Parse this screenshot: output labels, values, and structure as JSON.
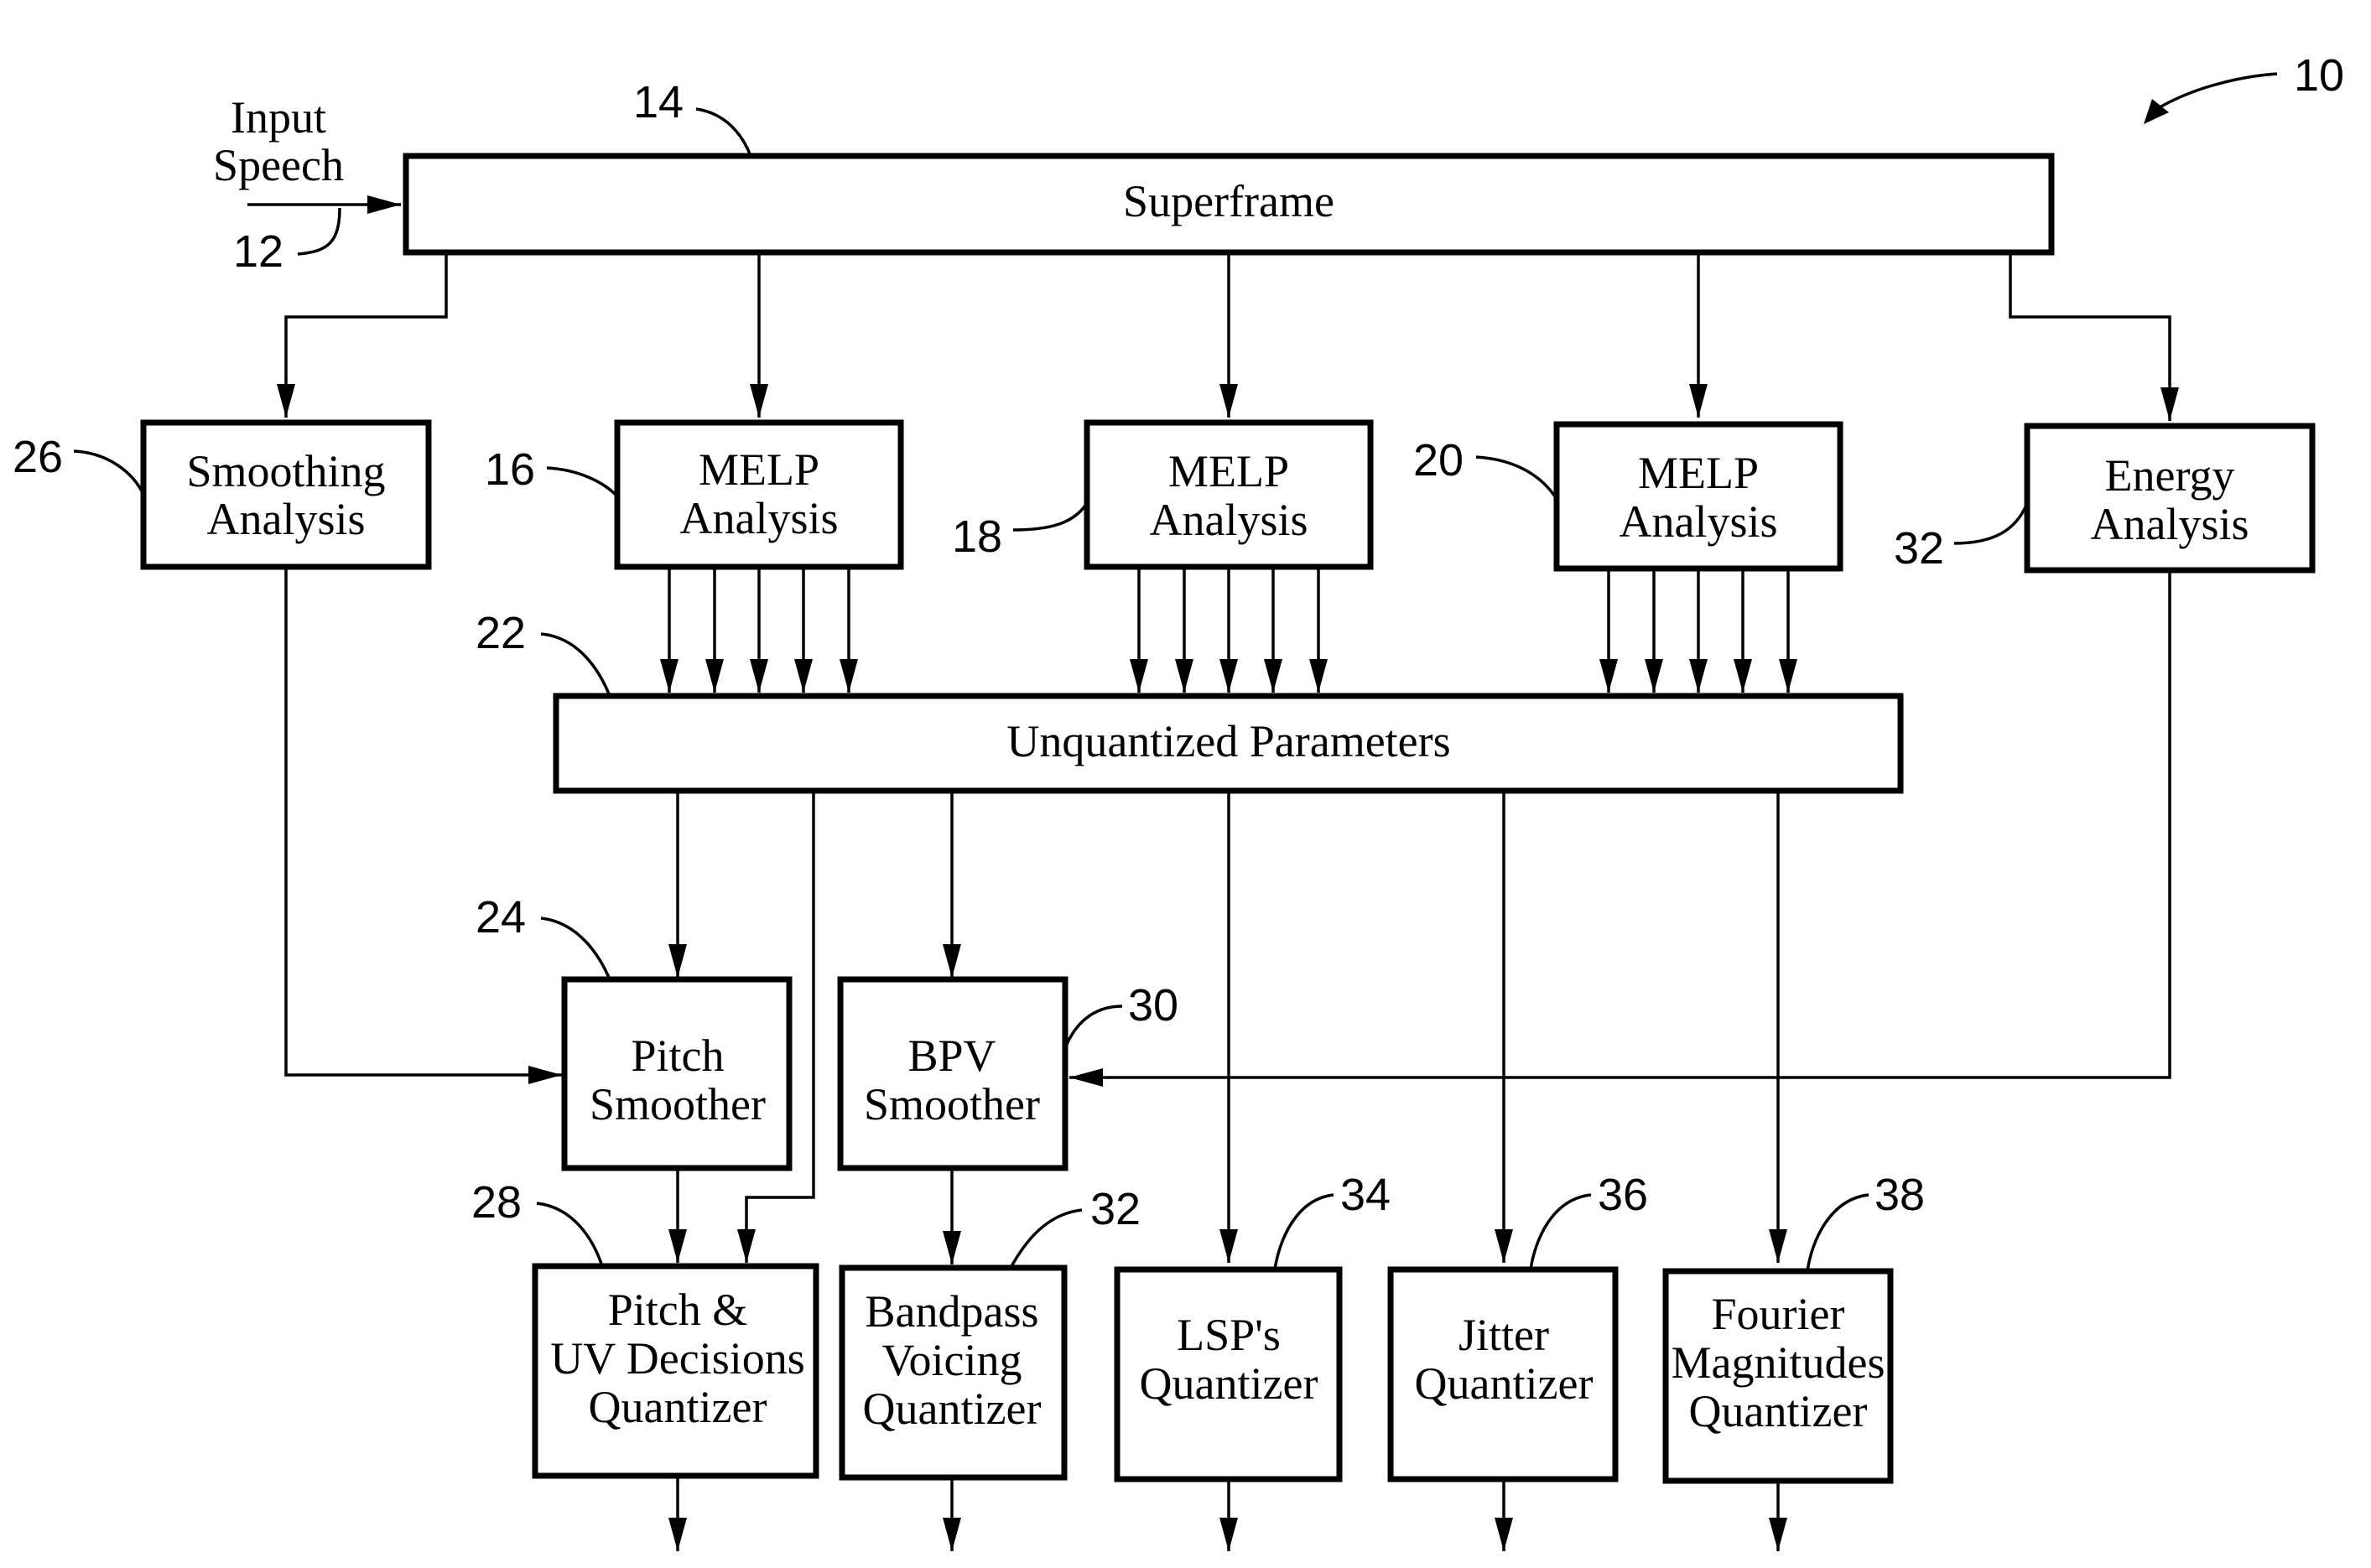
{
  "figure": {
    "ref": "10",
    "input": {
      "label_line1": "Input",
      "label_line2": "Speech",
      "ref": "12"
    },
    "superframe": {
      "label": "Superframe",
      "ref": "14"
    },
    "analysis_blocks": [
      {
        "id": "smoothing",
        "lines": [
          "Smoothing",
          "Analysis"
        ],
        "ref": "26"
      },
      {
        "id": "melp1",
        "lines": [
          "MELP",
          "Analysis"
        ],
        "ref": "16"
      },
      {
        "id": "melp2",
        "lines": [
          "MELP",
          "Analysis"
        ],
        "ref": "18"
      },
      {
        "id": "melp3",
        "lines": [
          "MELP",
          "Analysis"
        ],
        "ref": "20"
      },
      {
        "id": "energy",
        "lines": [
          "Energy",
          "Analysis"
        ],
        "ref": "32"
      }
    ],
    "unquantized": {
      "label": "Unquantized  Parameters",
      "ref": "22"
    },
    "smoothers": [
      {
        "id": "pitch-smoother",
        "lines": [
          "Pitch",
          "Smoother"
        ],
        "ref": "24"
      },
      {
        "id": "bpv-smoother",
        "lines": [
          "BPV",
          "Smoother"
        ],
        "ref": "30"
      }
    ],
    "quantizers": [
      {
        "id": "pitch-uv",
        "lines": [
          "Pitch &",
          "UV Decisions",
          "Quantizer"
        ],
        "ref": "28"
      },
      {
        "id": "bandpass",
        "lines": [
          "Bandpass",
          "Voicing",
          "Quantizer"
        ],
        "ref": "32"
      },
      {
        "id": "lsp",
        "lines": [
          "LSP's",
          "Quantizer"
        ],
        "ref": "34"
      },
      {
        "id": "jitter",
        "lines": [
          "Jitter",
          "Quantizer"
        ],
        "ref": "36"
      },
      {
        "id": "fourier",
        "lines": [
          "Fourier",
          "Magnitudes",
          "Quantizer"
        ],
        "ref": "38"
      }
    ]
  }
}
